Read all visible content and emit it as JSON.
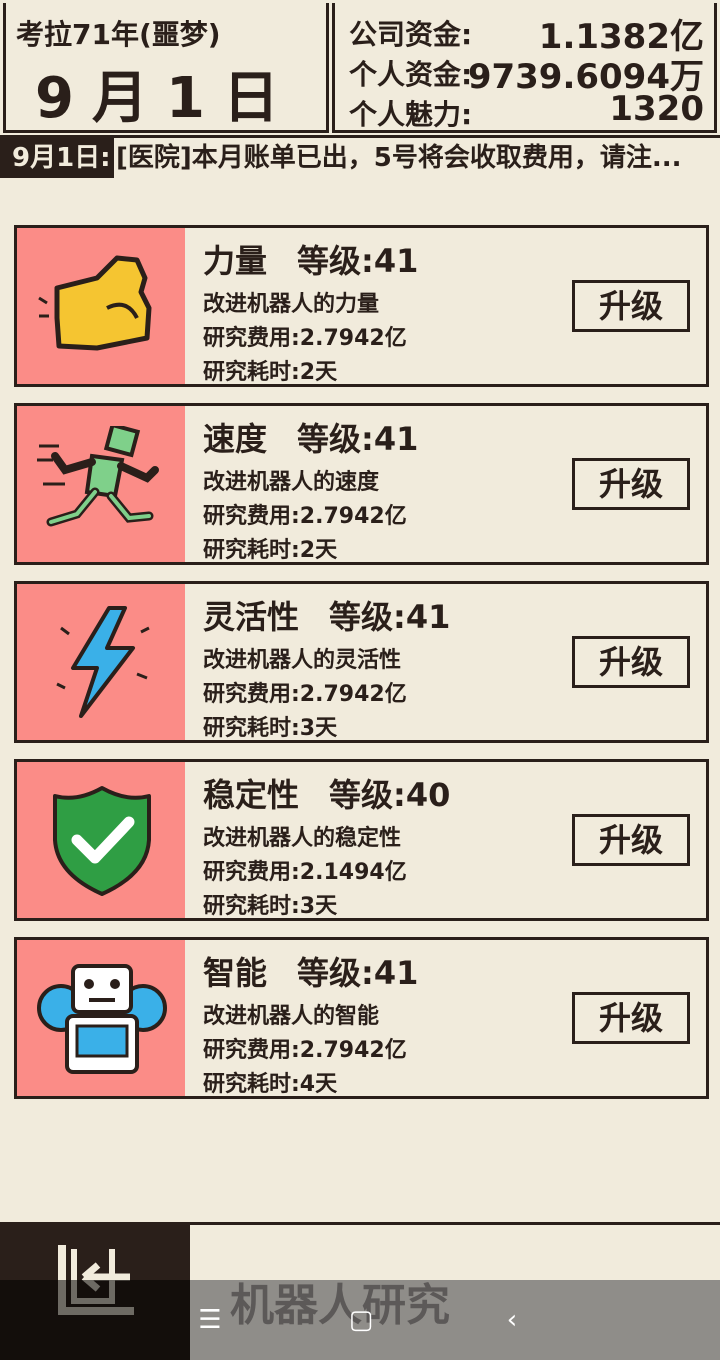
{
  "header": {
    "era": "考拉71年(噩梦)",
    "date": "9月1日",
    "funds": [
      {
        "label": "公司资金:",
        "value": "1.1382亿"
      },
      {
        "label": "个人资金:",
        "value": "9739.6094万"
      },
      {
        "label": "个人魅力:",
        "value": "1320"
      }
    ]
  },
  "ticker": {
    "date": "9月1日:",
    "message": "[医院]本月账单已出，5号将会收取费用，请注..."
  },
  "research": [
    {
      "name": "力量",
      "level": "等级:41",
      "desc": "改进机器人的力量",
      "cost": "研究费用:2.7942亿",
      "time": "研究耗时:2天",
      "button": "升级",
      "icon": "flexed-arm-icon"
    },
    {
      "name": "速度",
      "level": "等级:41",
      "desc": "改进机器人的速度",
      "cost": "研究费用:2.7942亿",
      "time": "研究耗时:2天",
      "button": "升级",
      "icon": "running-robot-icon"
    },
    {
      "name": "灵活性",
      "level": "等级:41",
      "desc": "改进机器人的灵活性",
      "cost": "研究费用:2.7942亿",
      "time": "研究耗时:3天",
      "button": "升级",
      "icon": "lightning-icon"
    },
    {
      "name": "稳定性",
      "level": "等级:40",
      "desc": "改进机器人的稳定性",
      "cost": "研究费用:2.1494亿",
      "time": "研究耗时:3天",
      "button": "升级",
      "icon": "shield-check-icon"
    },
    {
      "name": "智能",
      "level": "等级:41",
      "desc": "改进机器人的智能",
      "cost": "研究费用:2.7942亿",
      "time": "研究耗时:4天",
      "button": "升级",
      "icon": "robot-gear-icon"
    }
  ],
  "footer": {
    "title": "机器人研究",
    "back_icon": "exit-door-icon"
  },
  "navbar": {
    "menu_icon": "menu-icon",
    "home_icon": "home-icon",
    "back_icon": "back-icon"
  },
  "colors": {
    "background": "#f1ebdc",
    "ink": "#2a1f1a",
    "icon_bg": "#fb8c87"
  }
}
